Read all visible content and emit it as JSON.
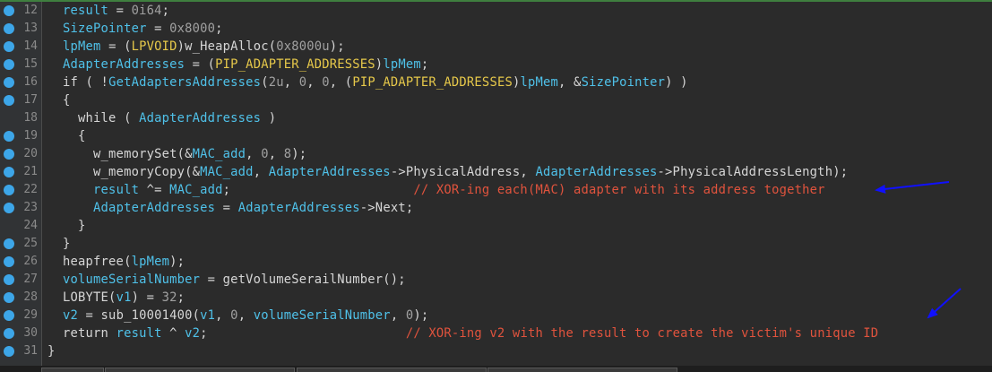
{
  "theme": {
    "background": "#2b2b2b",
    "gutter_bg": "#313335",
    "gutter_divider": "#4b4b4b",
    "line_number_color": "#8a8a8a",
    "breakpoint_dot": "#3da6e8",
    "top_accent": "#3f7f3f",
    "default_text": "#d6d6d6",
    "keyword": "#d6d6d6",
    "identifier": "#4fc1e9",
    "type_yellow": "#e6c84a",
    "number": "#a0a0a0",
    "comment": "#e0533d",
    "arrow": "#1010ff",
    "status_strip": "#1e1e1e"
  },
  "lines": [
    {
      "num": "12",
      "dot": true,
      "tokens": [
        {
          "t": "  ",
          "c": "d"
        },
        {
          "t": "result",
          "c": "i"
        },
        {
          "t": " = ",
          "c": "d"
        },
        {
          "t": "0i64",
          "c": "n"
        },
        {
          "t": ";",
          "c": "d"
        }
      ]
    },
    {
      "num": "13",
      "dot": true,
      "tokens": [
        {
          "t": "  ",
          "c": "d"
        },
        {
          "t": "SizePointer",
          "c": "i"
        },
        {
          "t": " = ",
          "c": "d"
        },
        {
          "t": "0x8000",
          "c": "n"
        },
        {
          "t": ";",
          "c": "d"
        }
      ]
    },
    {
      "num": "14",
      "dot": true,
      "tokens": [
        {
          "t": "  ",
          "c": "d"
        },
        {
          "t": "lpMem",
          "c": "i"
        },
        {
          "t": " = (",
          "c": "d"
        },
        {
          "t": "LPVOID",
          "c": "y"
        },
        {
          "t": ")w_HeapAlloc(",
          "c": "d"
        },
        {
          "t": "0x8000u",
          "c": "n"
        },
        {
          "t": ");",
          "c": "d"
        }
      ]
    },
    {
      "num": "15",
      "dot": true,
      "tokens": [
        {
          "t": "  ",
          "c": "d"
        },
        {
          "t": "AdapterAddresses",
          "c": "i"
        },
        {
          "t": " = (",
          "c": "d"
        },
        {
          "t": "PIP_ADAPTER_ADDRESSES",
          "c": "y"
        },
        {
          "t": ")",
          "c": "d"
        },
        {
          "t": "lpMem",
          "c": "i"
        },
        {
          "t": ";",
          "c": "d"
        }
      ]
    },
    {
      "num": "16",
      "dot": true,
      "tokens": [
        {
          "t": "  if ( !",
          "c": "d"
        },
        {
          "t": "GetAdaptersAddresses",
          "c": "i"
        },
        {
          "t": "(",
          "c": "d"
        },
        {
          "t": "2u",
          "c": "n"
        },
        {
          "t": ", ",
          "c": "d"
        },
        {
          "t": "0",
          "c": "n"
        },
        {
          "t": ", ",
          "c": "d"
        },
        {
          "t": "0",
          "c": "n"
        },
        {
          "t": ", (",
          "c": "d"
        },
        {
          "t": "PIP_ADAPTER_ADDRESSES",
          "c": "y"
        },
        {
          "t": ")",
          "c": "d"
        },
        {
          "t": "lpMem",
          "c": "i"
        },
        {
          "t": ", &",
          "c": "d"
        },
        {
          "t": "SizePointer",
          "c": "i"
        },
        {
          "t": ") )",
          "c": "d"
        }
      ]
    },
    {
      "num": "17",
      "dot": true,
      "tokens": [
        {
          "t": "  {",
          "c": "d"
        }
      ]
    },
    {
      "num": "18",
      "dot": false,
      "tokens": [
        {
          "t": "    while ( ",
          "c": "d"
        },
        {
          "t": "AdapterAddresses",
          "c": "i"
        },
        {
          "t": " )",
          "c": "d"
        }
      ]
    },
    {
      "num": "19",
      "dot": true,
      "tokens": [
        {
          "t": "    {",
          "c": "d"
        }
      ]
    },
    {
      "num": "20",
      "dot": true,
      "tokens": [
        {
          "t": "      w_memorySet(&",
          "c": "d"
        },
        {
          "t": "MAC_add",
          "c": "i"
        },
        {
          "t": ", ",
          "c": "d"
        },
        {
          "t": "0",
          "c": "n"
        },
        {
          "t": ", ",
          "c": "d"
        },
        {
          "t": "8",
          "c": "n"
        },
        {
          "t": ");",
          "c": "d"
        }
      ]
    },
    {
      "num": "21",
      "dot": true,
      "tokens": [
        {
          "t": "      w_memoryCopy(&",
          "c": "d"
        },
        {
          "t": "MAC_add",
          "c": "i"
        },
        {
          "t": ", ",
          "c": "d"
        },
        {
          "t": "AdapterAddresses",
          "c": "i"
        },
        {
          "t": "->PhysicalAddress, ",
          "c": "d"
        },
        {
          "t": "AdapterAddresses",
          "c": "i"
        },
        {
          "t": "->PhysicalAddressLength);",
          "c": "d"
        }
      ]
    },
    {
      "num": "22",
      "dot": true,
      "tokens": [
        {
          "t": "      ",
          "c": "d"
        },
        {
          "t": "result",
          "c": "i"
        },
        {
          "t": " ^= ",
          "c": "d"
        },
        {
          "t": "MAC_add",
          "c": "i"
        },
        {
          "t": ";                        ",
          "c": "d"
        },
        {
          "t": "// XOR-ing each(MAC) adapter with its address together",
          "c": "c"
        }
      ]
    },
    {
      "num": "23",
      "dot": true,
      "tokens": [
        {
          "t": "      ",
          "c": "d"
        },
        {
          "t": "AdapterAddresses",
          "c": "i"
        },
        {
          "t": " = ",
          "c": "d"
        },
        {
          "t": "AdapterAddresses",
          "c": "i"
        },
        {
          "t": "->Next;",
          "c": "d"
        }
      ]
    },
    {
      "num": "24",
      "dot": false,
      "tokens": [
        {
          "t": "    }",
          "c": "d"
        }
      ]
    },
    {
      "num": "25",
      "dot": true,
      "tokens": [
        {
          "t": "  }",
          "c": "d"
        }
      ]
    },
    {
      "num": "26",
      "dot": true,
      "tokens": [
        {
          "t": "  heapfree(",
          "c": "d"
        },
        {
          "t": "lpMem",
          "c": "i"
        },
        {
          "t": ");",
          "c": "d"
        }
      ]
    },
    {
      "num": "27",
      "dot": true,
      "tokens": [
        {
          "t": "  ",
          "c": "d"
        },
        {
          "t": "volumeSerialNumber",
          "c": "i"
        },
        {
          "t": " = getVolumeSerailNumber();",
          "c": "d"
        }
      ]
    },
    {
      "num": "28",
      "dot": true,
      "tokens": [
        {
          "t": "  LOBYTE(",
          "c": "d"
        },
        {
          "t": "v1",
          "c": "i"
        },
        {
          "t": ") = ",
          "c": "d"
        },
        {
          "t": "32",
          "c": "n"
        },
        {
          "t": ";",
          "c": "d"
        }
      ]
    },
    {
      "num": "29",
      "dot": true,
      "tokens": [
        {
          "t": "  ",
          "c": "d"
        },
        {
          "t": "v2",
          "c": "i"
        },
        {
          "t": " = sub_10001400(",
          "c": "d"
        },
        {
          "t": "v1",
          "c": "i"
        },
        {
          "t": ", ",
          "c": "d"
        },
        {
          "t": "0",
          "c": "n"
        },
        {
          "t": ", ",
          "c": "d"
        },
        {
          "t": "volumeSerialNumber",
          "c": "i"
        },
        {
          "t": ", ",
          "c": "d"
        },
        {
          "t": "0",
          "c": "n"
        },
        {
          "t": ");",
          "c": "d"
        }
      ]
    },
    {
      "num": "30",
      "dot": true,
      "tokens": [
        {
          "t": "  return ",
          "c": "d"
        },
        {
          "t": "result",
          "c": "i"
        },
        {
          "t": " ^ ",
          "c": "d"
        },
        {
          "t": "v2",
          "c": "i"
        },
        {
          "t": ";                          ",
          "c": "d"
        },
        {
          "t": "// XOR-ing v2 with the result to create the victim's unique ID",
          "c": "c"
        }
      ]
    },
    {
      "num": "31",
      "dot": true,
      "tokens": [
        {
          "t": "}",
          "c": "d"
        }
      ]
    }
  ]
}
